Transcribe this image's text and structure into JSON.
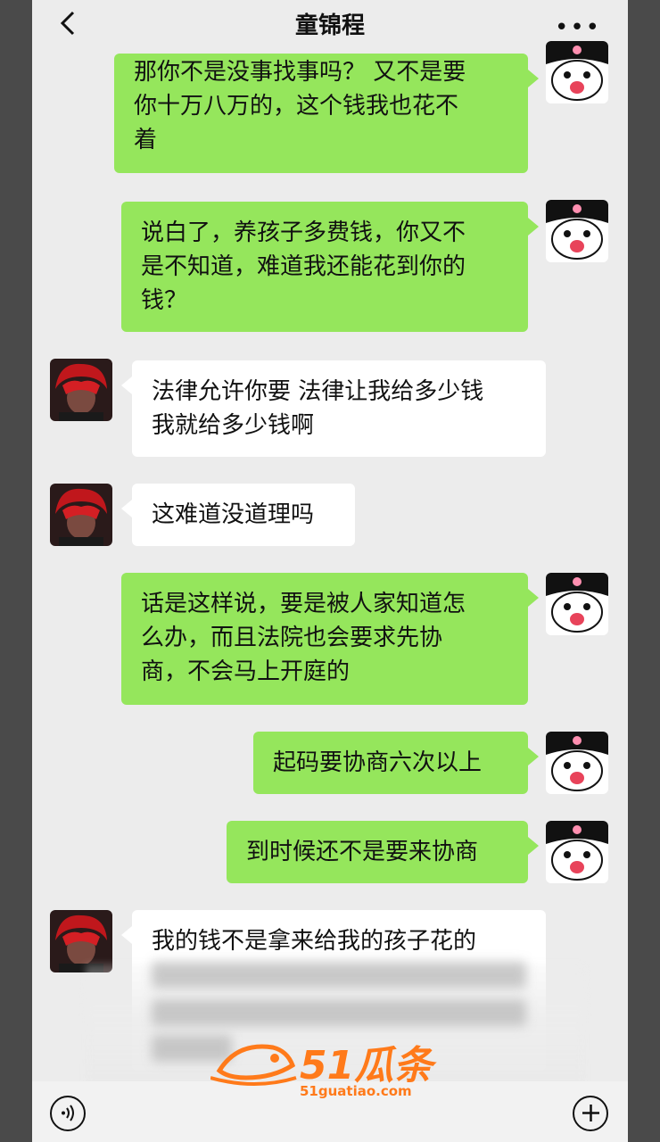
{
  "header": {
    "title": "童锦程",
    "more": "•••"
  },
  "messages": [
    {
      "side": "sent",
      "lines": [
        "那你不是没事找事吗？ 又不是要",
        "你十万八万的，这个钱我也花不",
        "着"
      ]
    },
    {
      "side": "sent",
      "lines": [
        "说白了，养孩子多费钱，你又不",
        "是不知道，难道我还能花到你的",
        "钱？"
      ]
    },
    {
      "side": "recv",
      "lines": [
        "法律允许你要 法律让我给多少钱",
        "我就给多少钱啊"
      ]
    },
    {
      "side": "recv",
      "lines": [
        "这难道没道理吗"
      ]
    },
    {
      "side": "sent",
      "lines": [
        "话是这样说，要是被人家知道怎",
        "么办，而且法院也会要求先协",
        "商，不会马上开庭的"
      ]
    },
    {
      "side": "sent",
      "lines": [
        "起码要协商六次以上"
      ]
    },
    {
      "side": "sent",
      "lines": [
        "到时候还不是要来协商"
      ]
    },
    {
      "side": "recv",
      "lines": [
        "我的钱不是拿来给我的孩子花的"
      ]
    }
  ],
  "watermark": {
    "logo": "51瓜条",
    "url": "51guatiao.com"
  },
  "colors": {
    "sent_bubble": "#95e65c",
    "recv_bubble": "#ffffff",
    "background": "#ececec",
    "watermark": "#ff7a1a"
  },
  "icons": {
    "back": "chevron-left-icon",
    "more": "more-icon",
    "voice": "voice-icon",
    "add": "plus-icon"
  }
}
